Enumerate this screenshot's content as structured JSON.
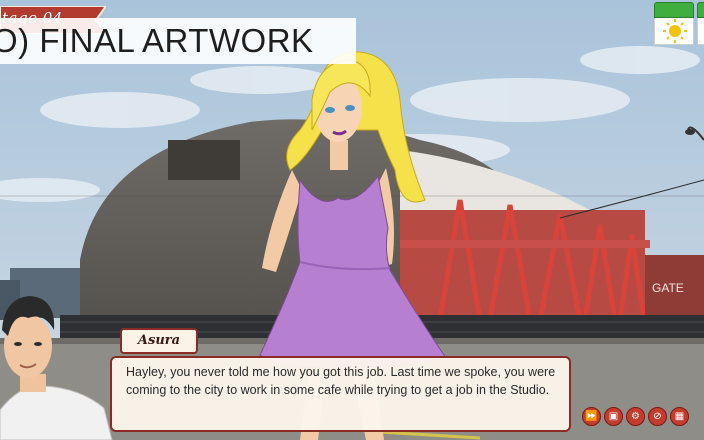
{
  "stage": {
    "label": "tage 04"
  },
  "banner": {
    "title": "O) FINAL ARTWORK"
  },
  "dialogue": {
    "speaker": "Asura",
    "text": "Hayley, you never told me how you got this job. Last time we spoke, you were coming to the city to work in some cafe while trying to get a job in the Studio."
  },
  "scene": {
    "sign_text": "GATE"
  },
  "quick_menu": [
    {
      "name": "skip-icon",
      "glyph": "⏩"
    },
    {
      "name": "save-icon",
      "glyph": "▣"
    },
    {
      "name": "settings-icon",
      "glyph": "⚙"
    },
    {
      "name": "hide-ui-icon",
      "glyph": "⊘"
    },
    {
      "name": "gallery-icon",
      "glyph": "▦"
    }
  ],
  "colors": {
    "accent": "#8a2b26",
    "button": "#c33c2e",
    "calendar_green": "#3fae3f",
    "sun": "#f4c20d"
  }
}
